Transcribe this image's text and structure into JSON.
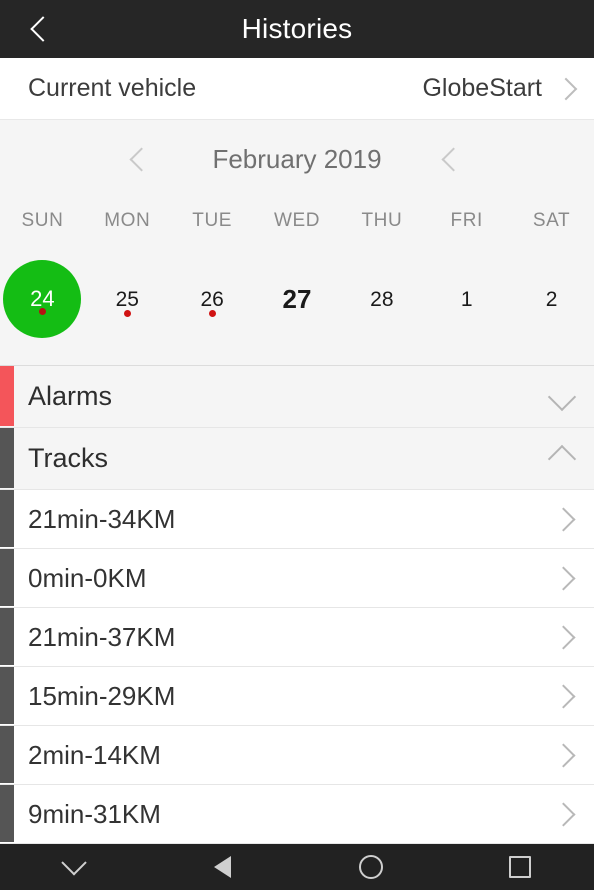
{
  "appbar": {
    "title": "Histories",
    "back_icon": "chevron-left-icon"
  },
  "vehicle": {
    "label": "Current vehicle",
    "value": "GlobeStart",
    "chevron_icon": "chevron-right-icon"
  },
  "calendar": {
    "month_label": "February 2019",
    "prev_icon": "chevron-left-icon",
    "next_icon": "chevron-right-icon",
    "weekdays": [
      "SUN",
      "MON",
      "TUE",
      "WED",
      "THU",
      "FRI",
      "SAT"
    ],
    "selected_color": "#14bd14",
    "event_dot_color": "#d01212",
    "days": [
      {
        "num": "24",
        "selected": true,
        "today": false,
        "dot": true
      },
      {
        "num": "25",
        "selected": false,
        "today": false,
        "dot": true
      },
      {
        "num": "26",
        "selected": false,
        "today": false,
        "dot": true
      },
      {
        "num": "27",
        "selected": false,
        "today": true,
        "dot": false
      },
      {
        "num": "28",
        "selected": false,
        "today": false,
        "dot": false
      },
      {
        "num": "1",
        "selected": false,
        "today": false,
        "dot": false
      },
      {
        "num": "2",
        "selected": false,
        "today": false,
        "dot": false
      }
    ]
  },
  "sections": [
    {
      "label": "Alarms",
      "accent_color": "#f4555a",
      "expanded": false,
      "toggle_icon": "chevron-down-icon"
    },
    {
      "label": "Tracks",
      "accent_color": "#555555",
      "expanded": true,
      "toggle_icon": "chevron-up-icon"
    }
  ],
  "tracks": [
    {
      "label": "21min-34KM",
      "chevron_icon": "chevron-right-icon"
    },
    {
      "label": "0min-0KM",
      "chevron_icon": "chevron-right-icon"
    },
    {
      "label": "21min-37KM",
      "chevron_icon": "chevron-right-icon"
    },
    {
      "label": "15min-29KM",
      "chevron_icon": "chevron-right-icon"
    },
    {
      "label": "2min-14KM",
      "chevron_icon": "chevron-right-icon"
    },
    {
      "label": "9min-31KM",
      "chevron_icon": "chevron-right-icon"
    }
  ],
  "navbar": {
    "items": [
      {
        "icon": "keyboard-hide-icon"
      },
      {
        "icon": "back-triangle-icon"
      },
      {
        "icon": "home-circle-icon"
      },
      {
        "icon": "recents-square-icon"
      }
    ]
  }
}
